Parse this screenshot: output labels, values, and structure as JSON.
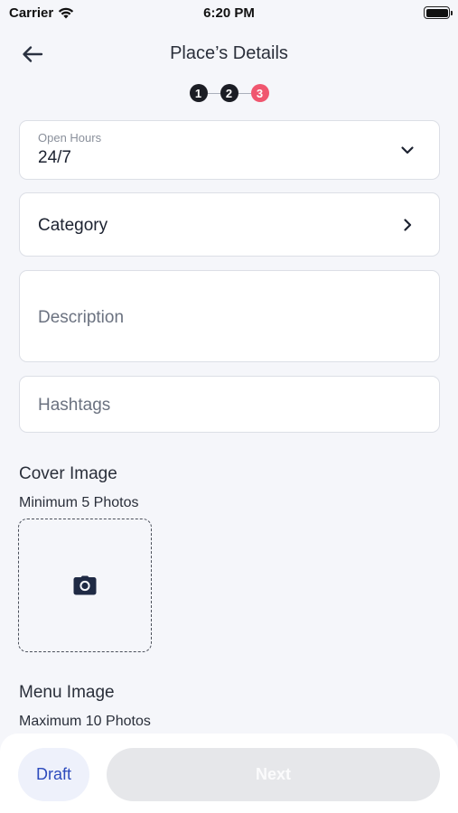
{
  "status_bar": {
    "carrier": "Carrier",
    "time": "6:20 PM"
  },
  "header": {
    "title": "Place’s Details",
    "back_icon": "arrow-left-icon"
  },
  "stepper": {
    "steps": [
      "1",
      "2",
      "3"
    ],
    "current_step": 3
  },
  "form": {
    "open_hours": {
      "label": "Open Hours",
      "value": "24/7",
      "icon": "chevron-down-icon"
    },
    "category": {
      "label": "Category",
      "icon": "chevron-right-icon"
    },
    "description": {
      "placeholder": "Description"
    },
    "hashtags": {
      "placeholder": "Hashtags"
    }
  },
  "cover_image": {
    "title": "Cover Image",
    "subtitle": "Minimum 5 Photos",
    "icon": "camera-icon"
  },
  "menu_image": {
    "title": "Menu Image",
    "subtitle": "Maximum 10 Photos"
  },
  "footer": {
    "draft_label": "Draft",
    "next_label": "Next"
  },
  "colors": {
    "accent": "#2d4bbd",
    "active_step": "#f0566f",
    "done_step": "#1b1d24",
    "background": "#f5f6fa"
  }
}
